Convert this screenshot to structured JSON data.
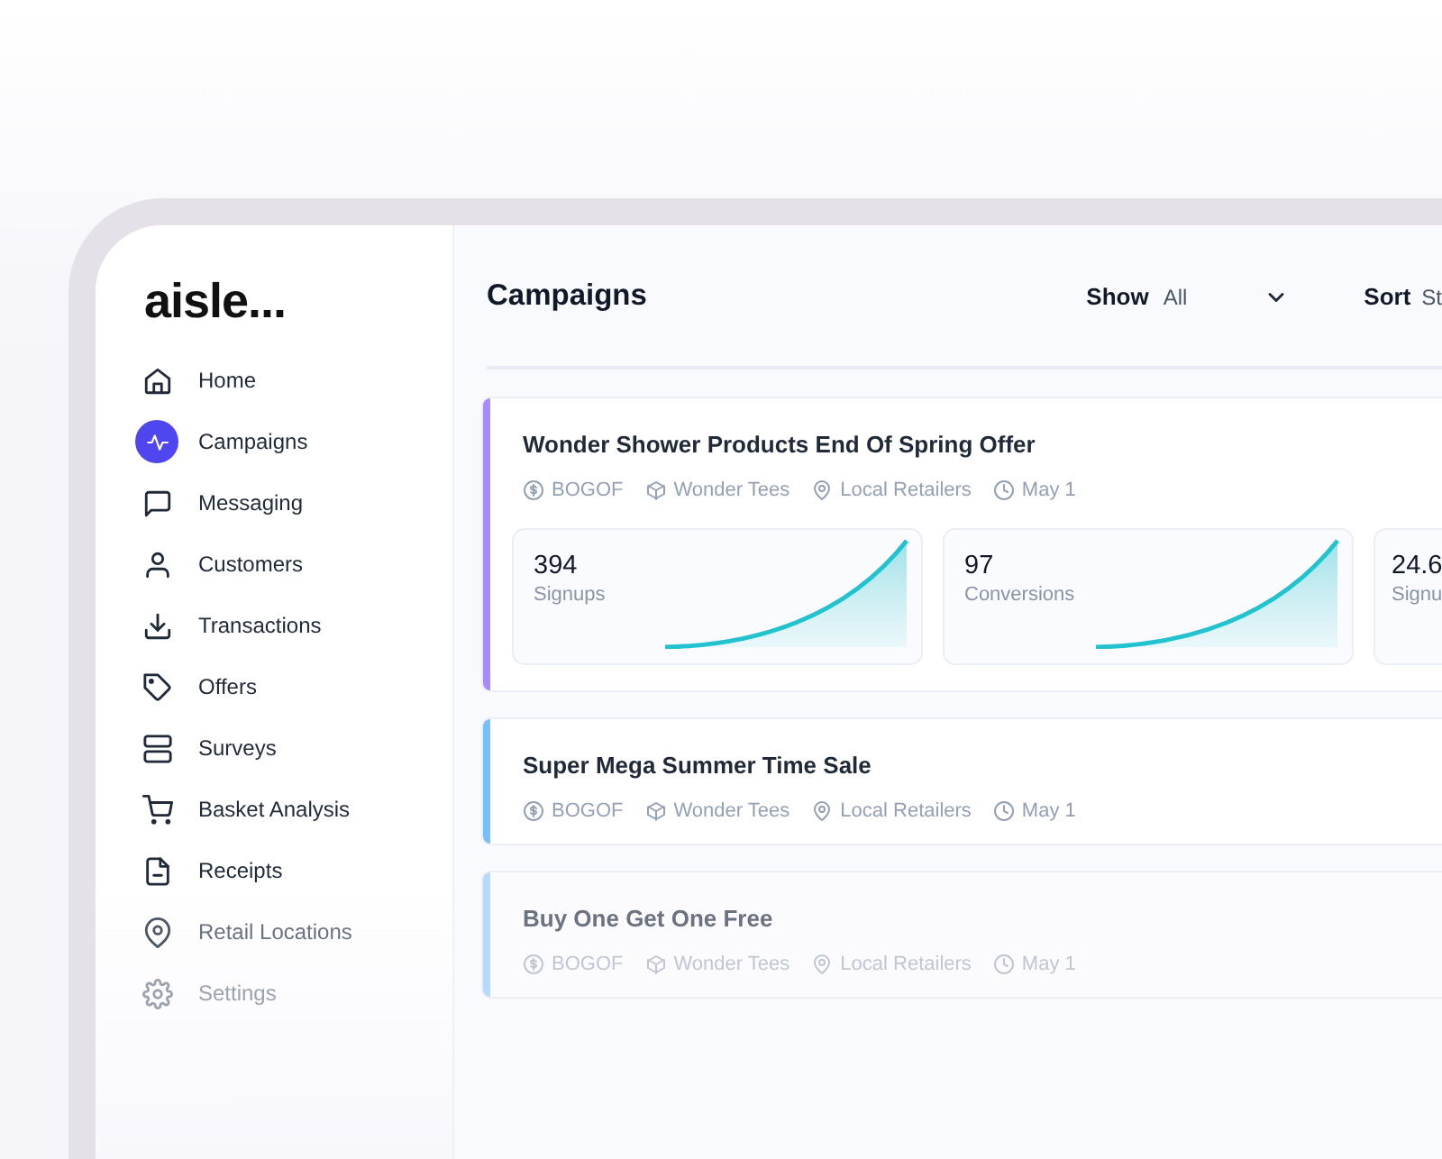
{
  "logo": "aisle...",
  "sidebar": {
    "items": [
      {
        "label": "Home",
        "selected": false
      },
      {
        "label": "Campaigns",
        "selected": true
      },
      {
        "label": "Messaging",
        "selected": false
      },
      {
        "label": "Customers",
        "selected": false
      },
      {
        "label": "Transactions",
        "selected": false
      },
      {
        "label": "Offers",
        "selected": false
      },
      {
        "label": "Surveys",
        "selected": false
      },
      {
        "label": "Basket Analysis",
        "selected": false
      },
      {
        "label": "Receipts",
        "selected": false
      },
      {
        "label": "Retail Locations",
        "selected": false
      },
      {
        "label": "Settings",
        "selected": false
      }
    ]
  },
  "header": {
    "title": "Campaigns",
    "show": {
      "label": "Show",
      "value": "All"
    },
    "sort": {
      "label": "Sort",
      "value": "St"
    }
  },
  "campaigns": [
    {
      "title": "Wonder Shower Products End Of Spring Offer",
      "color": "#a78bfa",
      "meta": [
        {
          "kind": "offer",
          "text": "BOGOF"
        },
        {
          "kind": "product",
          "text": "Wonder Tees"
        },
        {
          "kind": "location",
          "text": "Local Retailers"
        },
        {
          "kind": "date",
          "text": "May 1"
        }
      ],
      "stats": [
        {
          "value": "394",
          "label": "Signups"
        },
        {
          "value": "97",
          "label": "Conversions"
        },
        {
          "value": "24.6",
          "label": "Signu"
        }
      ]
    },
    {
      "title": "Super Mega Summer Time Sale",
      "color": "#74c0fc",
      "meta": [
        {
          "kind": "offer",
          "text": "BOGOF"
        },
        {
          "kind": "product",
          "text": "Wonder Tees"
        },
        {
          "kind": "location",
          "text": "Local Retailers"
        },
        {
          "kind": "date",
          "text": "May 1"
        }
      ]
    },
    {
      "title": "Buy One Get One Free",
      "color": "#b6dafb",
      "meta": [
        {
          "kind": "offer",
          "text": "BOGOF"
        },
        {
          "kind": "product",
          "text": "Wonder Tees"
        },
        {
          "kind": "location",
          "text": "Local Retailers"
        },
        {
          "kind": "date",
          "text": "May 1"
        }
      ]
    }
  ]
}
